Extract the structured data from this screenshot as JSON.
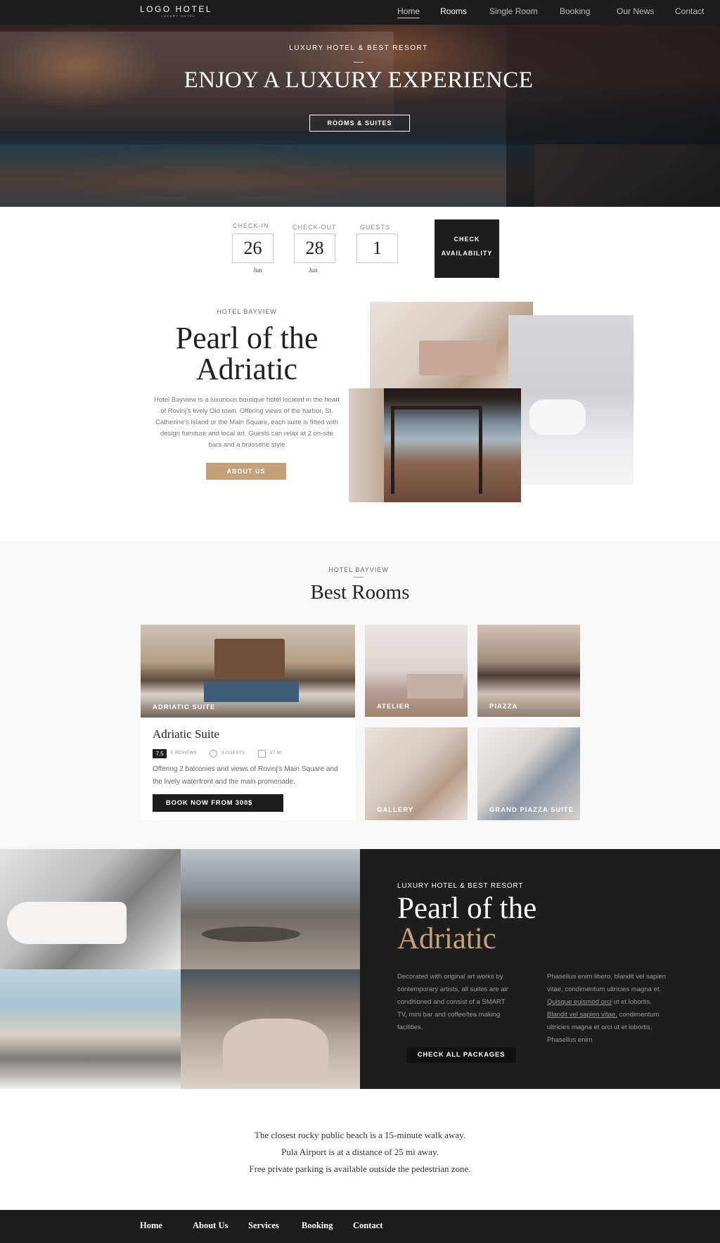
{
  "nav": {
    "logo": "LOGO HOTEL",
    "logo_sub": "LUXURY HOTEL",
    "links": [
      "Home",
      "Rooms",
      "Single Room",
      "Booking",
      "Our News",
      "Contact"
    ]
  },
  "hero": {
    "kicker": "LUXURY HOTEL & BEST RESORT",
    "title": "ENJOY A LUXURY EXPERIENCE",
    "button": "ROOMS & SUITES"
  },
  "booking": {
    "checkin_label": "CHECK-IN",
    "checkin_day": "26",
    "checkin_month": "Jun",
    "checkout_label": "CHECK-OUT",
    "checkout_day": "28",
    "checkout_month": "Jun",
    "guests_label": "GUESTS",
    "guests_value": "1",
    "button_line1": "CHECK",
    "button_line2": "AVAILABILITY"
  },
  "intro": {
    "kicker": "HOTEL BAYVIEW",
    "title_line1": "Pearl of the",
    "title_line2": "Adriatic",
    "text": "Hotel Bayview is a luxurious boutique hotel located in the heart of Rovinj's lively Old town. Offering views of the harbor, St. Catherine's Island or the Main Square, each suite is fitted with design furniture and local art. Guests can relax at 2 on-site bars and a brasserie style",
    "button": "ABOUT US"
  },
  "rooms": {
    "kicker": "HOTEL BAYVIEW",
    "title": "Best Rooms",
    "featured_caption": "ADRIATIC SUITE",
    "featured_title": "Adriatic Suite",
    "rating": "7.5",
    "reviews": "5 REVIEWS",
    "guests": "3 GUESTS",
    "size": "57 M²",
    "description": "Offering 2 balconies and views of Rovinj's Main Square and the lively waterfront and the main promenade.",
    "book_button": "BOOK NOW FROM 300$",
    "tiles": [
      "ATELIER",
      "PIAZZA",
      "GALLERY",
      "GRAND PIAZZA SUITE"
    ]
  },
  "packages": {
    "kicker": "LUXURY HOTEL & BEST RESORT",
    "title_line1": "Pearl of the",
    "title_line2": "Adriatic",
    "col1": "Decorated with original art works by contemporary artists, all suites are air  conditioned and consist of a SMART TV, mini  bar and coffee/tea making facilities.",
    "col2_a": "Phasellus enim libero, blandit vel sapien vitae, condimentum ultricies magna et. ",
    "col2_link1": "Quisque euismod orci",
    "col2_b": " ut et lobortis. ",
    "col2_link2": "Blandit vel sapien vitae,",
    "col2_c": " condimentum ultricies magna et orci ut et lobortis, Phasellus enim",
    "button": "CHECK ALL PACKAGES"
  },
  "info": {
    "line1": "The closest rocky public beach is a 15-minute walk away.",
    "line2": "Pula Airport is at a distance of 25 mi away.",
    "line3": "Free private parking is available outside the pedestrian zone."
  },
  "footer": {
    "links": [
      "Home",
      "About Us",
      "Services",
      "Booking",
      "Contact"
    ]
  },
  "colors": {
    "accent": "#c4a07c",
    "dark": "#1d1d1d"
  }
}
